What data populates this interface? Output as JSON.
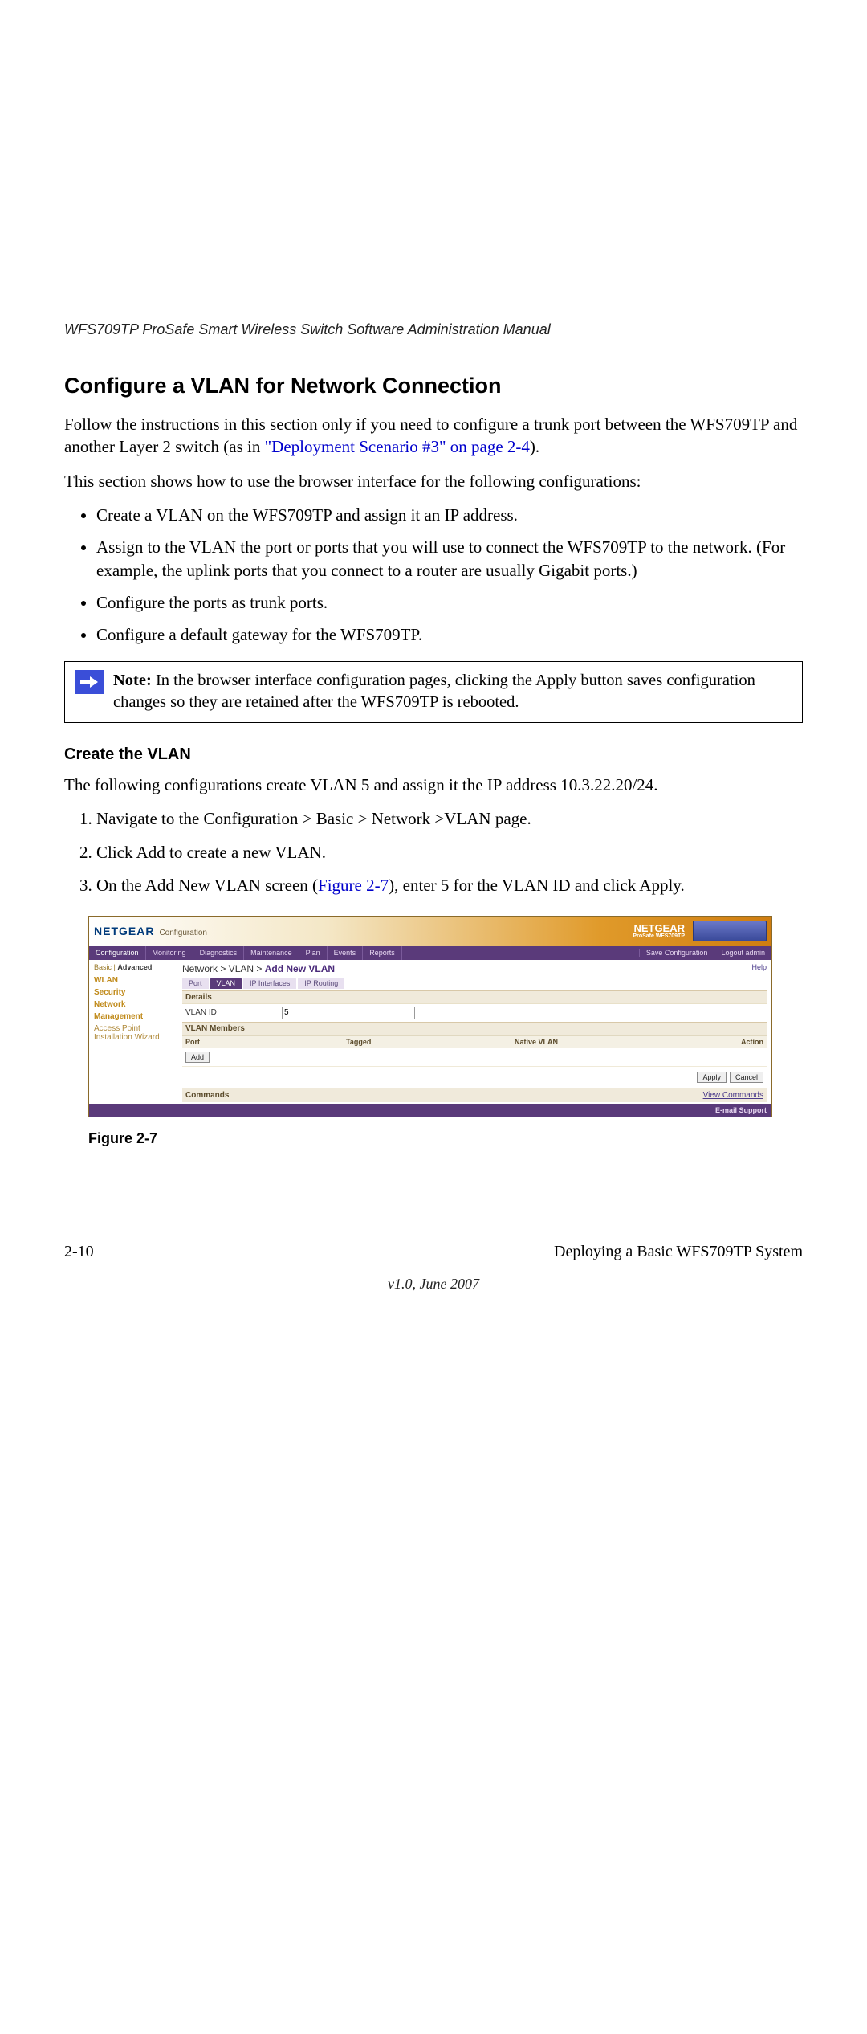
{
  "header": {
    "running": "WFS709TP ProSafe Smart Wireless Switch Software Administration Manual"
  },
  "title": "Configure a VLAN for Network Connection",
  "intro1a": "Follow the instructions in this section only if you need to configure a trunk port between the WFS709TP and another Layer 2 switch (as in ",
  "intro1_link": "\"Deployment Scenario #3\" on page 2-4",
  "intro1b": ").",
  "intro2": "This section shows how to use the browser interface for the following configurations:",
  "bullets": [
    "Create a VLAN on the WFS709TP and assign it an IP address.",
    "Assign to the VLAN the port or ports that you will use to connect the WFS709TP to the network. (For example, the uplink ports that you connect to a router are usually Gigabit ports.)",
    "Configure the ports as trunk ports.",
    "Configure a default gateway for the WFS709TP."
  ],
  "note_label": "Note:",
  "note_text": " In the browser interface configuration pages, clicking the Apply button saves configuration changes so they are retained after the WFS709TP is rebooted.",
  "subhead": "Create the VLAN",
  "sub_intro": "The following configurations create VLAN 5 and assign it the IP address 10.3.22.20/24.",
  "steps": {
    "s1": "Navigate to the Configuration > Basic > Network >VLAN page.",
    "s2": "Click Add to create a new VLAN.",
    "s3a": "On the Add New VLAN screen (",
    "s3_link": "Figure 2-7",
    "s3b": "), enter 5 for the VLAN ID and click Apply."
  },
  "screenshot": {
    "brand": "NETGEAR",
    "brand_sub": "Configuration",
    "right_brand": "NETGEAR",
    "right_model": "ProSafe WFS709TP",
    "tabs": [
      "Configuration",
      "Monitoring",
      "Diagnostics",
      "Maintenance",
      "Plan",
      "Events",
      "Reports"
    ],
    "right_links": [
      "Save Configuration",
      "Logout admin"
    ],
    "mode_basic": "Basic",
    "mode_sep": " | ",
    "mode_adv": "Advanced",
    "side_items": [
      "WLAN",
      "Security",
      "Network",
      "Management",
      "Access Point Installation Wizard"
    ],
    "help": "Help",
    "breadcrumb_a": "Network > VLAN > ",
    "breadcrumb_b": "Add New VLAN",
    "subtabs": [
      "Port",
      "VLAN",
      "IP Interfaces",
      "IP Routing"
    ],
    "panel_details": "Details",
    "vlan_id_label": "VLAN ID",
    "vlan_id_value": "5",
    "panel_members": "VLAN Members",
    "col_port": "Port",
    "col_tagged": "Tagged",
    "col_native": "Native VLAN",
    "col_action": "Action",
    "btn_add": "Add",
    "btn_apply": "Apply",
    "btn_cancel": "Cancel",
    "commands_label": "Commands",
    "view_commands": "View Commands",
    "footer_support": "E-mail Support"
  },
  "figure_caption": "Figure 2-7",
  "footer": {
    "page": "2-10",
    "chapter": "Deploying a Basic WFS709TP System",
    "version": "v1.0, June 2007"
  }
}
